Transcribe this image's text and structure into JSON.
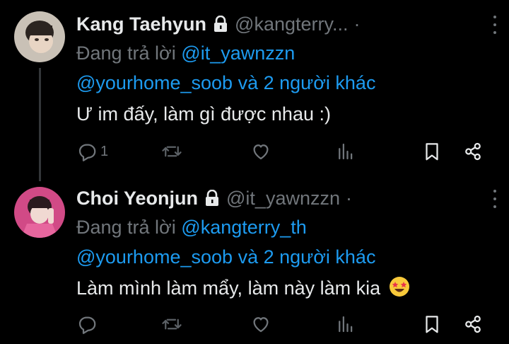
{
  "tweets": [
    {
      "display_name": "Kang Taehyun",
      "handle": "@kangterry...",
      "separator": "·",
      "reply_prefix": "Đang trả lời",
      "reply_to": "@it_yawnzzn",
      "reply_others_mention": "@yourhome_soob",
      "reply_others_suffix": "và 2 người khác",
      "text": "Ư im đấy, làm gì được nhau :)",
      "reply_count": "1",
      "avatar_icon": "avatar-photo"
    },
    {
      "display_name": "Choi Yeonjun",
      "handle": "@it_yawnzzn",
      "separator": "·",
      "reply_prefix": "Đang trả lời",
      "reply_to": "@kangterry_th",
      "reply_others_mention": "@yourhome_soob",
      "reply_others_suffix": "và 2 người khác",
      "text": "Làm mình làm mẩy, làm này làm kia",
      "emoji": "🤩",
      "reply_count": "",
      "avatar_icon": "avatar-photo"
    }
  ],
  "colors": {
    "background": "#000000",
    "text_primary": "#e7e9ea",
    "text_secondary": "#71767b",
    "link": "#1d9bf0",
    "thread_line": "#333639"
  },
  "icons": [
    "lock-icon",
    "more-icon",
    "reply-icon",
    "retweet-icon",
    "like-icon",
    "views-icon",
    "bookmark-icon",
    "share-icon",
    "star-struck-emoji"
  ]
}
